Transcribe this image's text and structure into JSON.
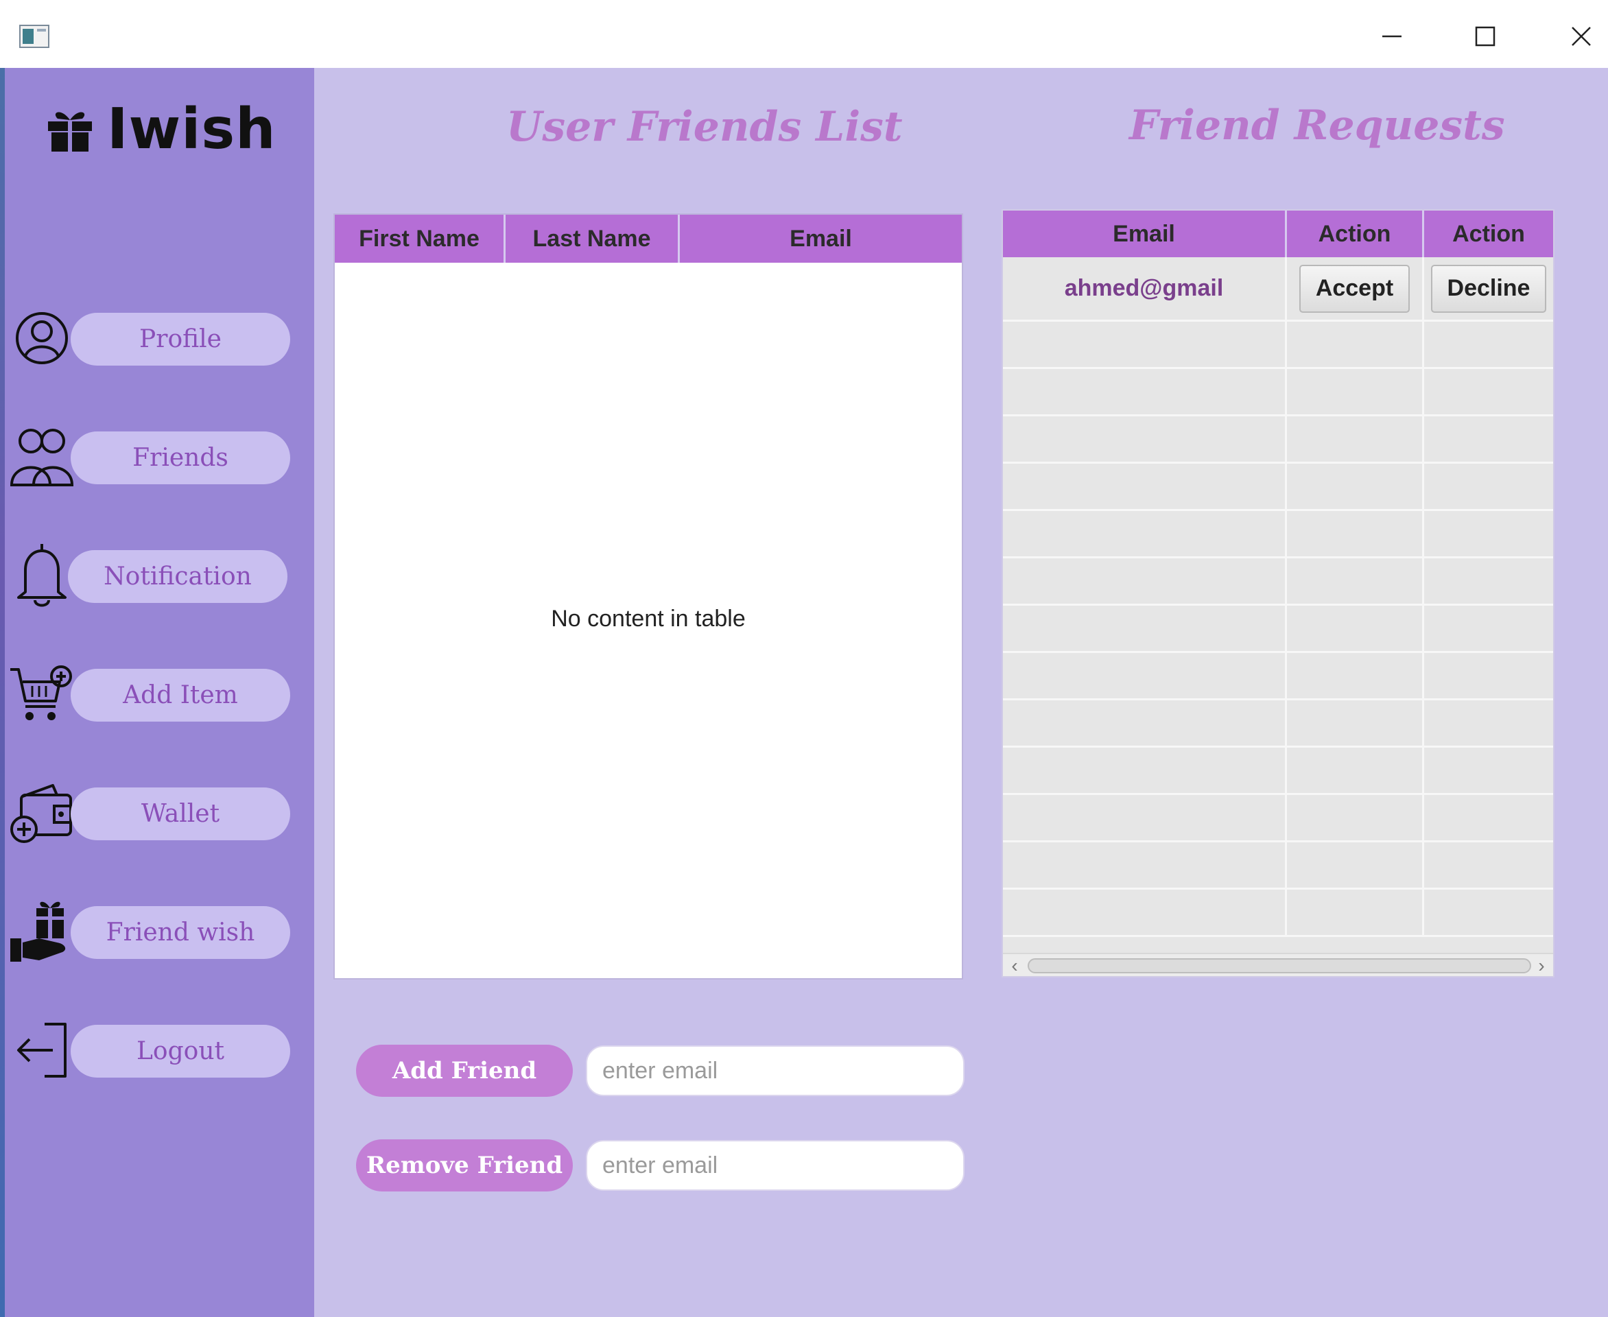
{
  "window": {
    "controls": [
      "minimize",
      "maximize",
      "close"
    ]
  },
  "brand": {
    "name": "Iwish"
  },
  "sidebar": {
    "items": [
      {
        "label": "Profile",
        "icon": "user-circle-icon"
      },
      {
        "label": "Friends",
        "icon": "users-icon"
      },
      {
        "label": "Notification",
        "icon": "bell-icon"
      },
      {
        "label": "Add Item",
        "icon": "cart-add-icon"
      },
      {
        "label": "Wallet",
        "icon": "wallet-add-icon"
      },
      {
        "label": "Friend wish",
        "icon": "gift-hand-icon"
      },
      {
        "label": "Logout",
        "icon": "logout-icon"
      }
    ]
  },
  "friends_list": {
    "title": "User Friends List",
    "columns": [
      "First Name",
      "Last Name",
      "Email"
    ],
    "rows": [],
    "empty_text": "No content in table"
  },
  "friend_requests": {
    "title": "Friend Requests",
    "columns": [
      "Email",
      "Action",
      "Action"
    ],
    "rows": [
      {
        "email": "ahmed@gmail",
        "accept_label": "Accept",
        "decline_label": "Decline"
      }
    ],
    "scroll_left": "‹",
    "scroll_right": "›"
  },
  "actions": {
    "add_friend": {
      "label": "Add Friend",
      "placeholder": "enter email"
    },
    "remove_friend": {
      "label": "Remove Friend",
      "placeholder": "enter email"
    }
  },
  "colors": {
    "sidebar": "#9886d6",
    "main_bg": "#c8c0ea",
    "header_purple": "#b56ed6",
    "title_text": "#b978cc",
    "pill": "#c9bff0",
    "action_button": "#c37fd6"
  }
}
